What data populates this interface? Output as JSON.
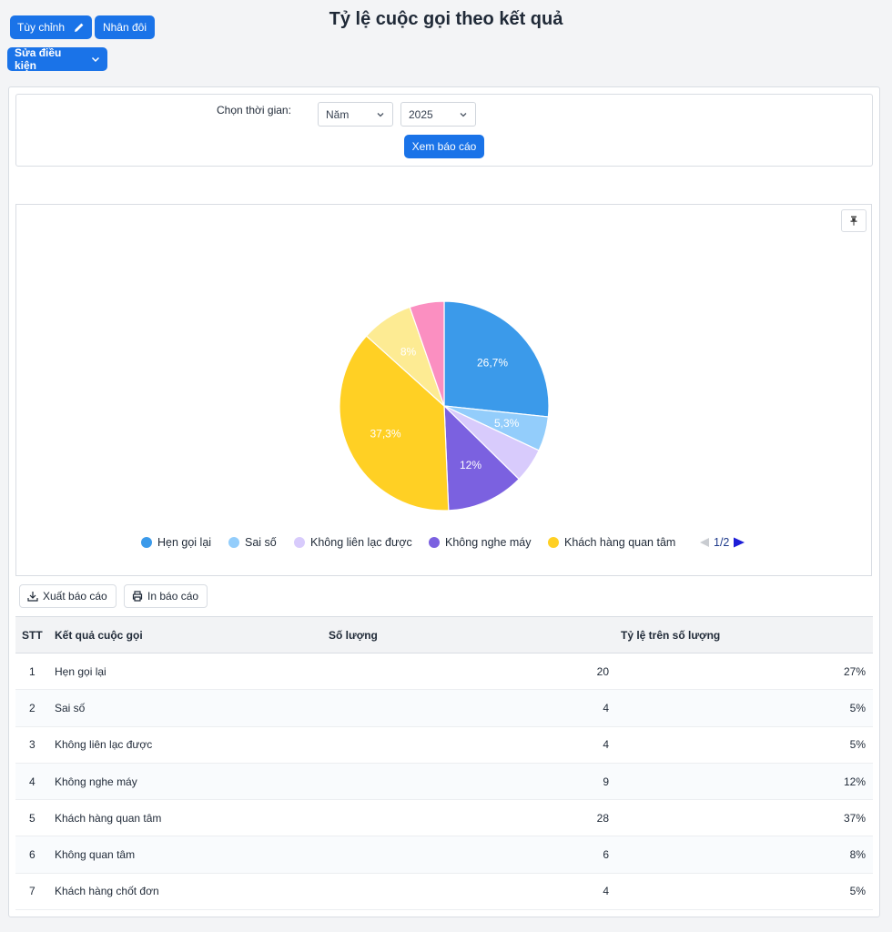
{
  "toolbar": {
    "customize_label": "Tùy chỉnh",
    "duplicate_label": "Nhân đôi",
    "edit_conditions_label": "Sửa điều kiện"
  },
  "page_title": "Tỷ lệ cuộc gọi theo kết quả",
  "filter": {
    "label": "Chọn thời gian:",
    "period_value": "Năm",
    "year_value": "2025",
    "submit_label": "Xem báo cáo"
  },
  "chart_data": {
    "type": "pie",
    "slices": [
      {
        "label": "Hẹn gọi lại",
        "value": 20,
        "percent_label": "26,7%",
        "color": "#3b9aea"
      },
      {
        "label": "Sai số",
        "value": 4,
        "percent_label": "5,3%",
        "color": "#93cdfb"
      },
      {
        "label": "Không liên lạc được",
        "value": 4,
        "percent_label": "",
        "color": "#d8cbfc"
      },
      {
        "label": "Không nghe máy",
        "value": 9,
        "percent_label": "12%",
        "color": "#7b61e0"
      },
      {
        "label": "Khách hàng quan tâm",
        "value": 28,
        "percent_label": "37,3%",
        "color": "#ffd024"
      },
      {
        "label": "Không quan tâm",
        "value": 6,
        "percent_label": "8%",
        "color": "#fdeb93"
      },
      {
        "label": "Khách hàng chốt đơn",
        "value": 4,
        "percent_label": "",
        "color": "#fb8fc1"
      }
    ],
    "legend_visible": [
      "Hẹn gọi lại",
      "Sai số",
      "Không liên lạc được",
      "Không nghe máy",
      "Khách hàng quan tâm"
    ],
    "legend_placement": "bottom",
    "legend_page": "1/2"
  },
  "actions": {
    "export_label": "Xuất báo cáo",
    "print_label": "In báo cáo"
  },
  "table": {
    "headers": [
      "STT",
      "Kết quả cuộc gọi",
      "Số lượng",
      "Tỷ lệ trên số lượng"
    ],
    "rows": [
      [
        "1",
        "Hẹn gọi lại",
        "20",
        "27%"
      ],
      [
        "2",
        "Sai số",
        "4",
        "5%"
      ],
      [
        "3",
        "Không liên lạc được",
        "4",
        "5%"
      ],
      [
        "4",
        "Không nghe máy",
        "9",
        "12%"
      ],
      [
        "5",
        "Khách hàng quan tâm",
        "28",
        "37%"
      ],
      [
        "6",
        "Không quan tâm",
        "6",
        "8%"
      ],
      [
        "7",
        "Khách hàng chốt đơn",
        "4",
        "5%"
      ]
    ]
  }
}
